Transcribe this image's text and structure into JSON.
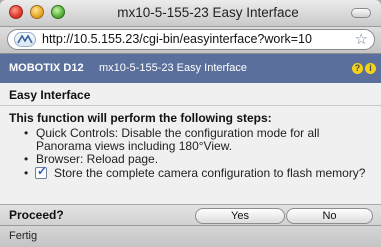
{
  "window": {
    "title": "mx10-5-155-23 Easy Interface"
  },
  "browser": {
    "url": "http://10.5.155.23/cgi-bin/easyinterface?work=10",
    "status": "Fertig"
  },
  "header": {
    "brand": "MOBOTIX D12",
    "host_title": "mx10-5-155-23 Easy Interface"
  },
  "page": {
    "section_title": "Easy Interface",
    "intro": "This function will perform the following steps:",
    "steps": {
      "quick_controls": "Quick Controls: Disable the configuration mode for all Panorama views including 180°View.",
      "browser_reload": "Browser: Reload page.",
      "store_config": "Store the complete camera configuration to flash memory?"
    },
    "store_config_checked": true,
    "proceed_label": "Proceed?",
    "yes_label": "Yes",
    "no_label": "No"
  },
  "colors": {
    "header_bg": "#5a6f9c",
    "help_icon": "#f5d21a"
  },
  "icons": {
    "close": "close-icon",
    "minimize": "minimize-icon",
    "zoom": "zoom-icon",
    "site": "site-identity-icon",
    "bookmark": "star-icon",
    "help": "help-icon",
    "check": "checkmark-icon"
  }
}
